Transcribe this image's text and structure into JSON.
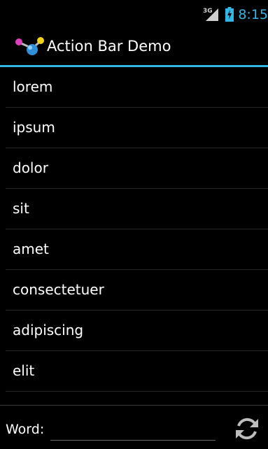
{
  "status_bar": {
    "network": "3G",
    "time": "8:15",
    "icons": [
      "signal-icon",
      "battery-charging-icon"
    ]
  },
  "action_bar": {
    "title": "Action Bar Demo",
    "icon": "app-logo-icon",
    "accent_color": "#33b5e5"
  },
  "list": {
    "items": [
      {
        "label": "lorem"
      },
      {
        "label": "ipsum"
      },
      {
        "label": "dolor"
      },
      {
        "label": "sit"
      },
      {
        "label": "amet"
      },
      {
        "label": "consectetuer"
      },
      {
        "label": "adipiscing"
      },
      {
        "label": "elit"
      }
    ]
  },
  "bottom_bar": {
    "word_label": "Word:",
    "word_value": "",
    "refresh_icon": "refresh-icon"
  }
}
